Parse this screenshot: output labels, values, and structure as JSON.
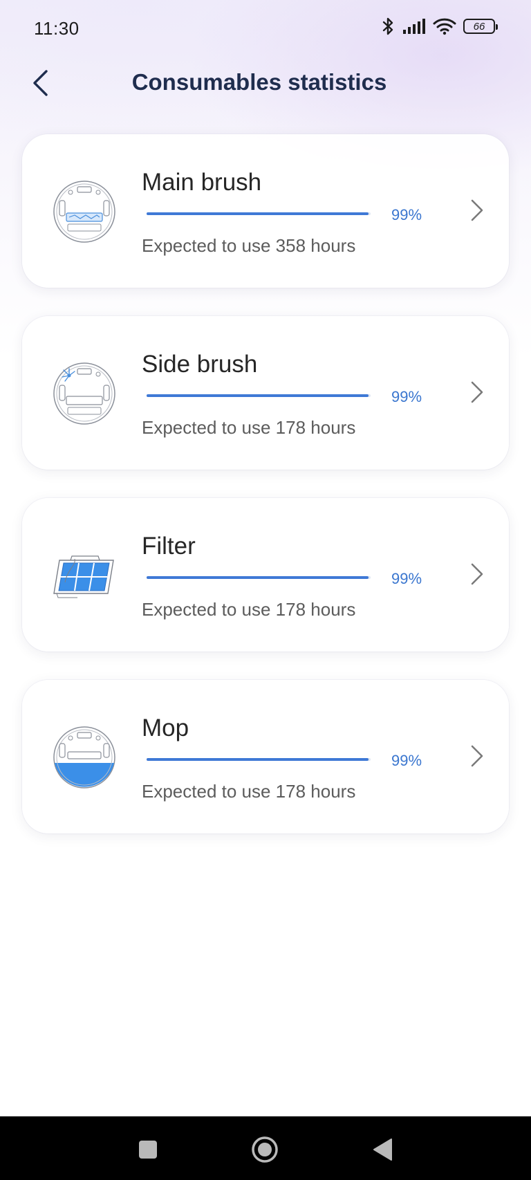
{
  "status_bar": {
    "time": "11:30",
    "battery": "66",
    "icons": [
      "bluetooth-icon",
      "signal-icon",
      "wifi-icon",
      "battery-icon"
    ]
  },
  "header": {
    "title": "Consumables statistics",
    "back_icon": "chevron-left-icon"
  },
  "consumables": [
    {
      "name": "Main brush",
      "percent_label": "99%",
      "percent": 99,
      "expected": "Expected to use 358 hours",
      "icon": "robot-main-brush-icon"
    },
    {
      "name": "Side brush",
      "percent_label": "99%",
      "percent": 99,
      "expected": "Expected to use 178 hours",
      "icon": "robot-side-brush-icon"
    },
    {
      "name": "Filter",
      "percent_label": "99%",
      "percent": 99,
      "expected": "Expected to use 178 hours",
      "icon": "filter-icon"
    },
    {
      "name": "Mop",
      "percent_label": "99%",
      "percent": 99,
      "expected": "Expected to use 178 hours",
      "icon": "robot-mop-icon"
    }
  ],
  "colors": {
    "accent": "#3f79d6",
    "title": "#1f2d4e",
    "nav_bar": "#000000"
  },
  "nav_bar": {
    "buttons": [
      "recents-square-icon",
      "home-circle-icon",
      "back-triangle-icon"
    ]
  }
}
